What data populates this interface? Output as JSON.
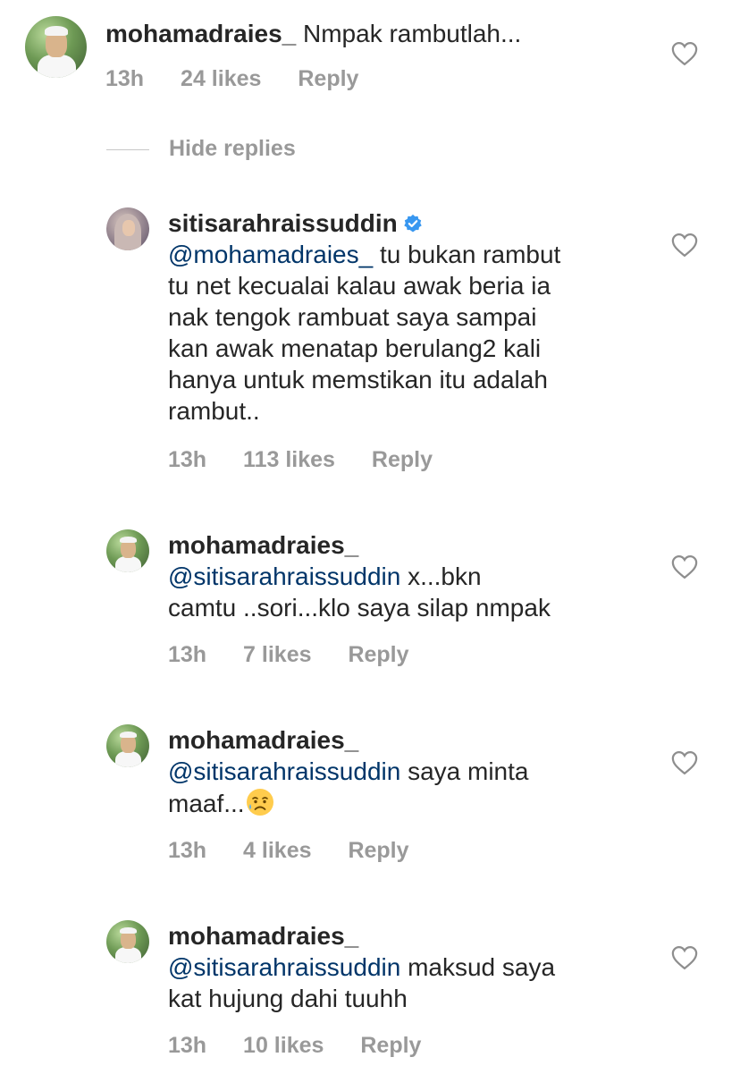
{
  "comments": [
    {
      "username": "mohamadraies_",
      "text": " Nmpak rambutlah...",
      "time": "13h",
      "likes": "24 likes",
      "reply": "Reply"
    }
  ],
  "hide_replies": "Hide replies",
  "replies": [
    {
      "username": "sitisarahraissuddin",
      "verified": true,
      "mention": "@mohamadraies_",
      "text_line1": " tu bukan rambut",
      "text_rest": [
        "tu net kecualai kalau awak beria ia",
        "nak tengok rambuat saya sampai",
        "kan awak menatap berulang2 kali",
        "hanya untuk memstikan itu adalah",
        "rambut.."
      ],
      "time": "13h",
      "likes": "113 likes",
      "reply": "Reply"
    },
    {
      "username": "mohamadraies_",
      "mention": "@sitisarahraissuddin",
      "text_line1": " x...bkn",
      "text_rest": [
        "camtu ..sori...klo saya silap nmpak"
      ],
      "time": "13h",
      "likes": "7 likes",
      "reply": "Reply"
    },
    {
      "username": "mohamadraies_",
      "mention": "@sitisarahraissuddin",
      "text_line1": " saya minta",
      "text_rest": [
        "maaf..."
      ],
      "emoji": "sad-sweat-emoji",
      "time": "13h",
      "likes": "4 likes",
      "reply": "Reply"
    },
    {
      "username": "mohamadraies_",
      "mention": "@sitisarahraissuddin",
      "text_line1": " maksud saya",
      "text_rest": [
        "kat hujung dahi tuuhh"
      ],
      "time": "13h",
      "likes": "10 likes",
      "reply": "Reply"
    }
  ],
  "colors": {
    "text": "#262626",
    "meta": "#999999",
    "mention": "#003569",
    "verified": "#3897f0"
  }
}
